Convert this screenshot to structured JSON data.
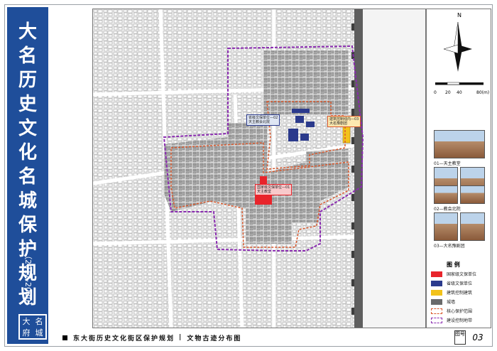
{
  "sidebar": {
    "title_chars": [
      "大",
      "名",
      "历",
      "史",
      "文",
      "化",
      "名",
      "城",
      "保",
      "护",
      "规",
      "划"
    ],
    "years": "（2012-2030）",
    "seal_chars": [
      "大",
      "名",
      "府",
      "城"
    ]
  },
  "map": {
    "labels": {
      "provincial": "省级文保单位—02\n天主教会北院",
      "national": "国家级文保单位—01\n天主教堂",
      "building": "建筑控制线内—03\n大名豫剧团"
    }
  },
  "compass": {
    "north": "N"
  },
  "scale": {
    "ticks": [
      "0",
      "20",
      "40",
      "80(m)"
    ]
  },
  "photos": [
    {
      "caption": "01—天主教堂"
    },
    {
      "caption": "02—教会北院"
    },
    {
      "caption": "03—大名豫剧团"
    }
  ],
  "legend": {
    "title": "图 例",
    "items": [
      {
        "label": "国家级文保单位",
        "color": "#e8242b",
        "kind": "fill"
      },
      {
        "label": "省级文保单位",
        "color": "#2b3a8c",
        "kind": "fill"
      },
      {
        "label": "建筑控制建筑",
        "color": "#f2c21a",
        "kind": "fill"
      },
      {
        "label": "城墙",
        "color": "#6a6a6a",
        "kind": "fill"
      },
      {
        "label": "核心保护范围",
        "color": "#d9572b",
        "kind": "dash"
      },
      {
        "label": "建设控制地带",
        "color": "#8a2bb0",
        "kind": "dash"
      }
    ]
  },
  "footer": {
    "title": "东大街历史文化街区保护规划",
    "separator": "|",
    "subtitle": "文物古迹分布图",
    "page_label": "图号",
    "page_num": "03"
  }
}
